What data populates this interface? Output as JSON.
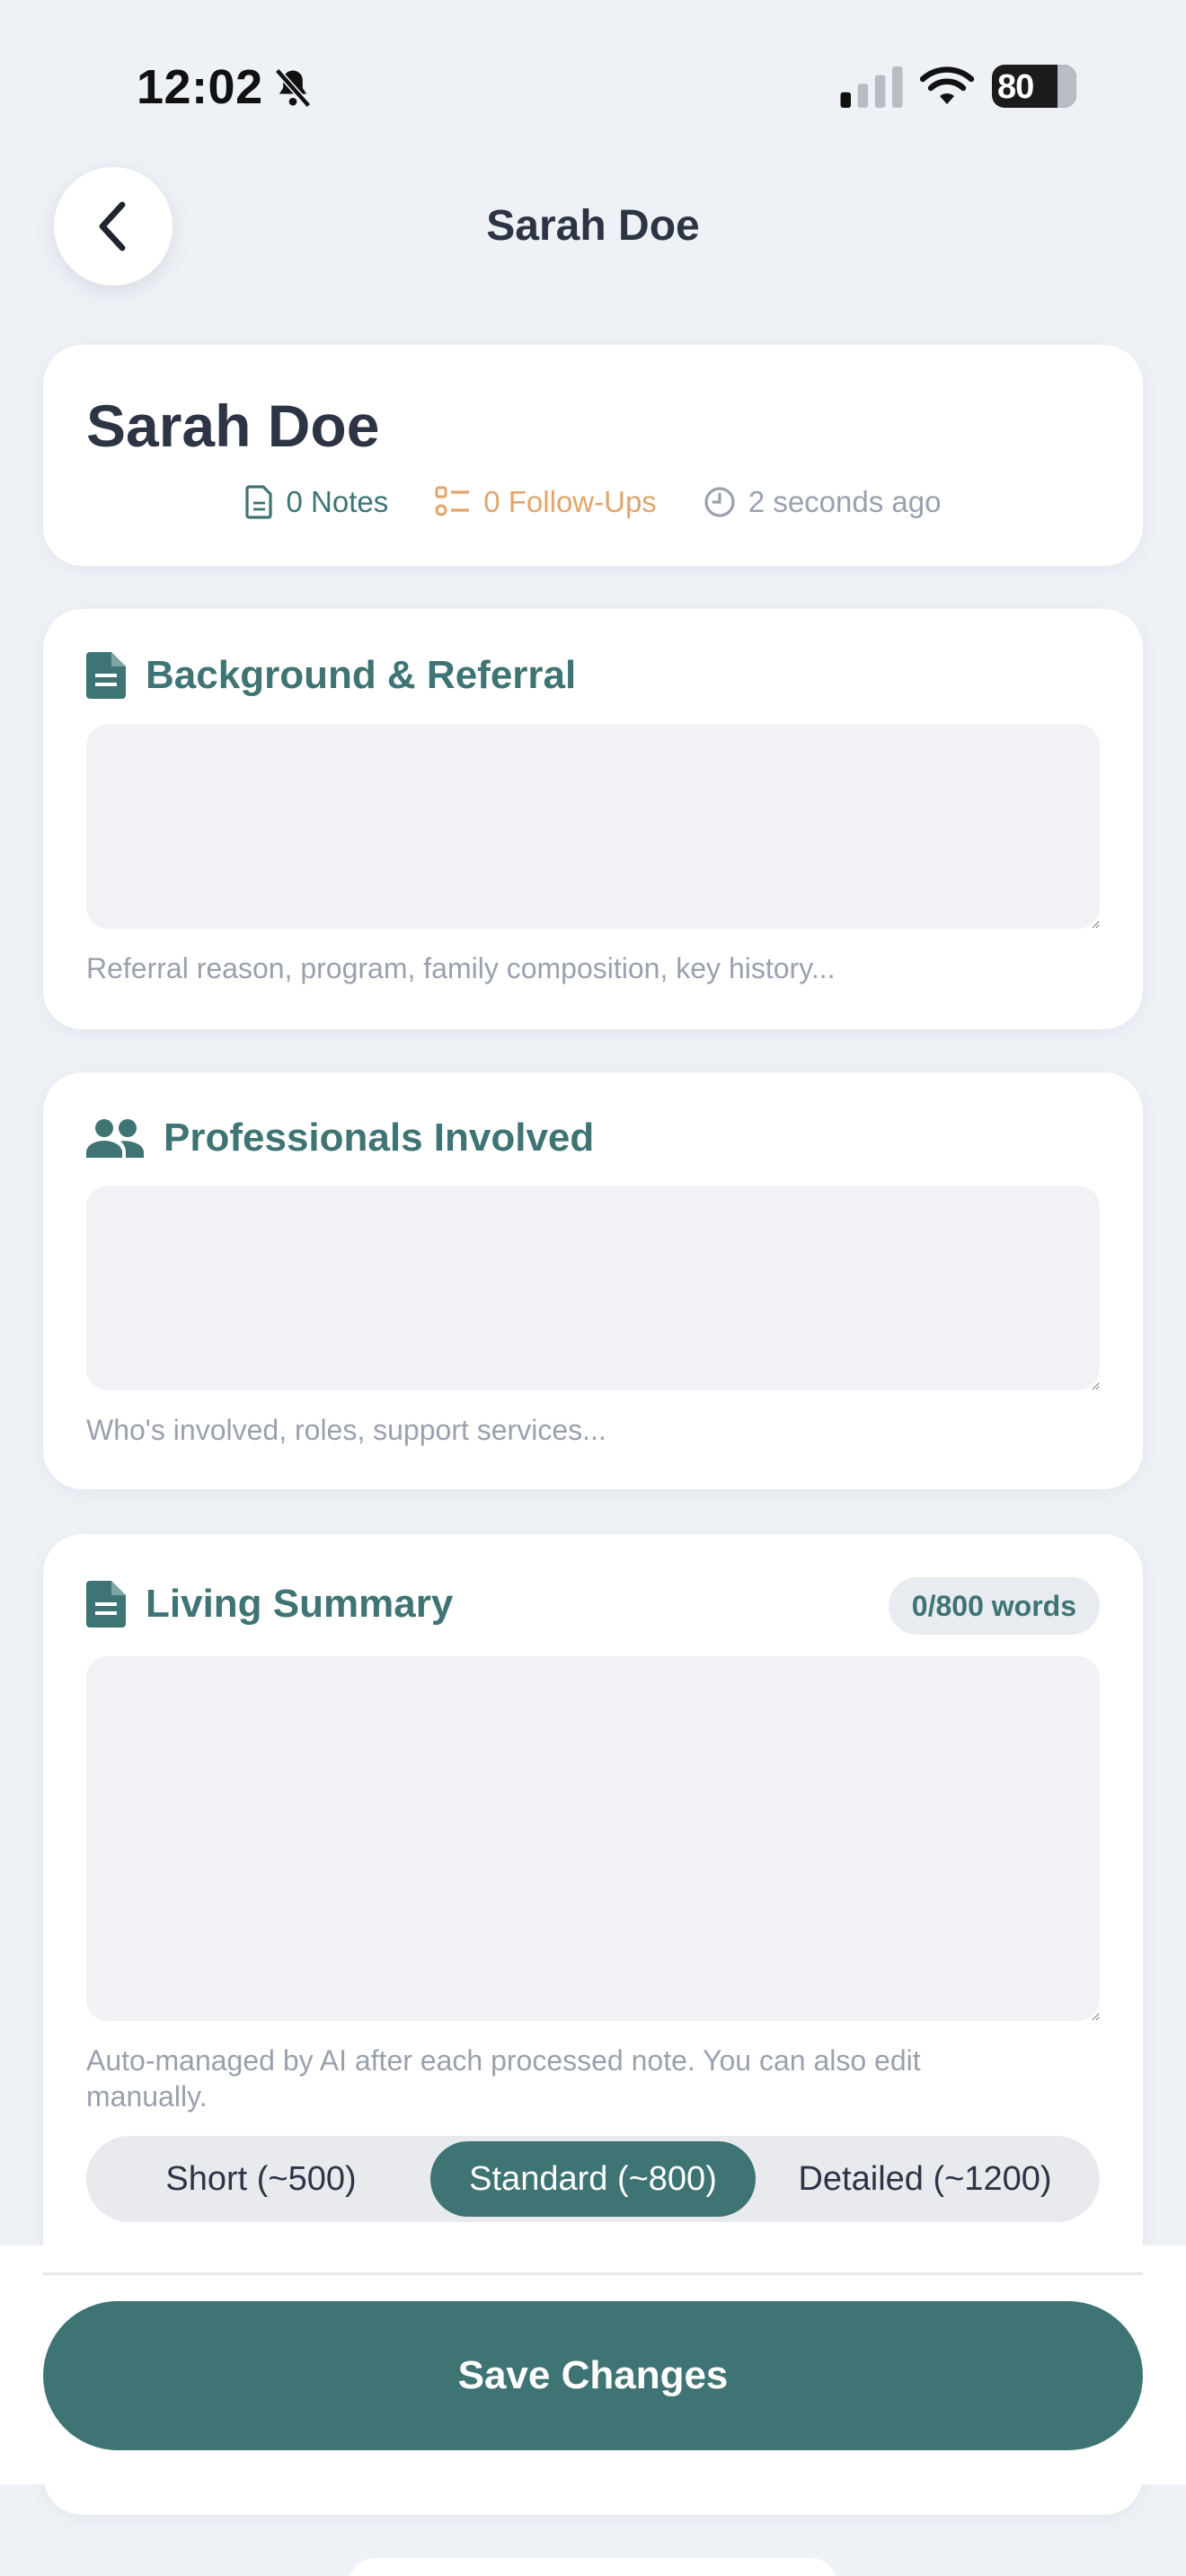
{
  "status_bar": {
    "time": "12:02",
    "battery_percent": "80",
    "icons": [
      "bell-slash-icon",
      "cellular-signal-icon",
      "wifi-icon",
      "battery-charging-icon"
    ]
  },
  "header": {
    "title": "Sarah Doe",
    "back_icon": "chevron-left-icon"
  },
  "profile": {
    "name": "Sarah Doe",
    "notes": "0 Notes",
    "followups": "0 Follow-Ups",
    "updated": "2 seconds ago"
  },
  "sections": {
    "background": {
      "title": "Background & Referral",
      "value": "",
      "hint": "Referral reason, program, family composition, key history..."
    },
    "professionals": {
      "title": "Professionals Involved",
      "value": "",
      "hint": "Who's involved, roles, support services..."
    },
    "living_summary": {
      "title": "Living Summary",
      "word_count": "0/800 words",
      "value": "",
      "hint": "Auto-managed by AI after each processed note. You can also edit manually.",
      "length_options": [
        "Short (~500)",
        "Standard (~800)",
        "Detailed (~1200)"
      ],
      "selected_option": "Standard (~800)"
    }
  },
  "actions": {
    "save_label": "Save Changes"
  },
  "colors": {
    "accent": "#3e7473",
    "followup": "#e1a56b",
    "background": "#eef1f6",
    "muted": "#9aa1ad"
  }
}
